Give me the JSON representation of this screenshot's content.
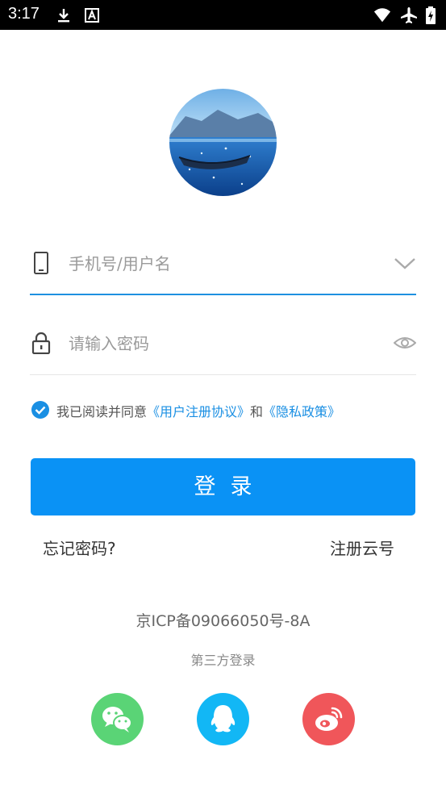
{
  "status_bar": {
    "time": "3:17"
  },
  "login": {
    "username_placeholder": "手机号/用户名",
    "password_placeholder": "请输入密码",
    "agreement": {
      "prefix": "我已阅读并同意",
      "user_agreement": "《用户注册协议》",
      "and": "和",
      "privacy_policy": "《隐私政策》"
    },
    "login_button": "登录",
    "forgot_password": "忘记密码?",
    "register": "注册云号"
  },
  "footer": {
    "icp": "京ICP备09066050号-8A",
    "third_party_title": "第三方登录"
  },
  "colors": {
    "primary": "#0a92f5",
    "wechat": "#5ad476",
    "qq": "#12b7f5",
    "weibo": "#f0565a"
  }
}
